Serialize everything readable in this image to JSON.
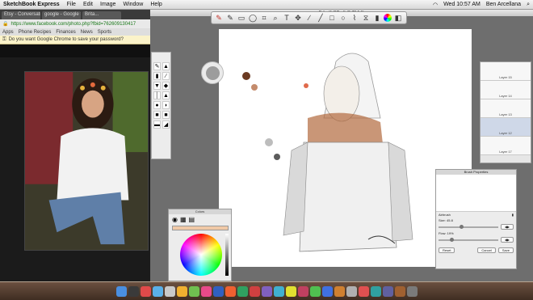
{
  "menubar": {
    "app": "SketchBook Express",
    "items": [
      "File",
      "Edit",
      "Image",
      "Window",
      "Help"
    ],
    "clock": "Wed 10:57 AM",
    "user": "Ben Arcellana"
  },
  "browser": {
    "tabs": [
      "Etsy - Conversations",
      "google - Google Search",
      "Brita..."
    ],
    "url": "https://www.facebook.com/photo.php?fbid=762609130417",
    "bookmarks": [
      "Apps",
      "Phone Recipes",
      "Finances",
      "News",
      "Sports"
    ],
    "password_prompt": "Do you want Google Chrome to save your password?"
  },
  "document": {
    "title": "Brita.tif @Draft @ 79.1 %"
  },
  "toolbar": {
    "icons": [
      "pencil-red-icon",
      "pencil-gray-icon",
      "rectangle-icon",
      "lasso-icon",
      "crop-icon",
      "zoom-icon",
      "text-icon",
      "move-icon",
      "brush-icon",
      "line-icon",
      "rect-shape-icon",
      "oval-icon",
      "polyline-icon",
      "symmetry-icon",
      "brush-library-icon",
      "color-wheel-icon",
      "palette-icon"
    ]
  },
  "layers": {
    "items": [
      {
        "label": "Layer 15"
      },
      {
        "label": "Layer 14"
      },
      {
        "label": "Layer 13"
      },
      {
        "label": "Layer 12"
      },
      {
        "label": "Layer 17"
      }
    ]
  },
  "color_window": {
    "title": "Colors"
  },
  "brush_props": {
    "title": "Brush Properties",
    "brush_name": "Airbrush",
    "size_label": "Size: 45.8",
    "flow_label": "Flow: 19%",
    "size_fraction": 0.35,
    "flow_fraction": 0.19,
    "reset": "Reset",
    "cancel": "Cancel",
    "save": "Save"
  },
  "colors": {
    "accent": "#2a6fd6",
    "dock": "#4a372b"
  }
}
